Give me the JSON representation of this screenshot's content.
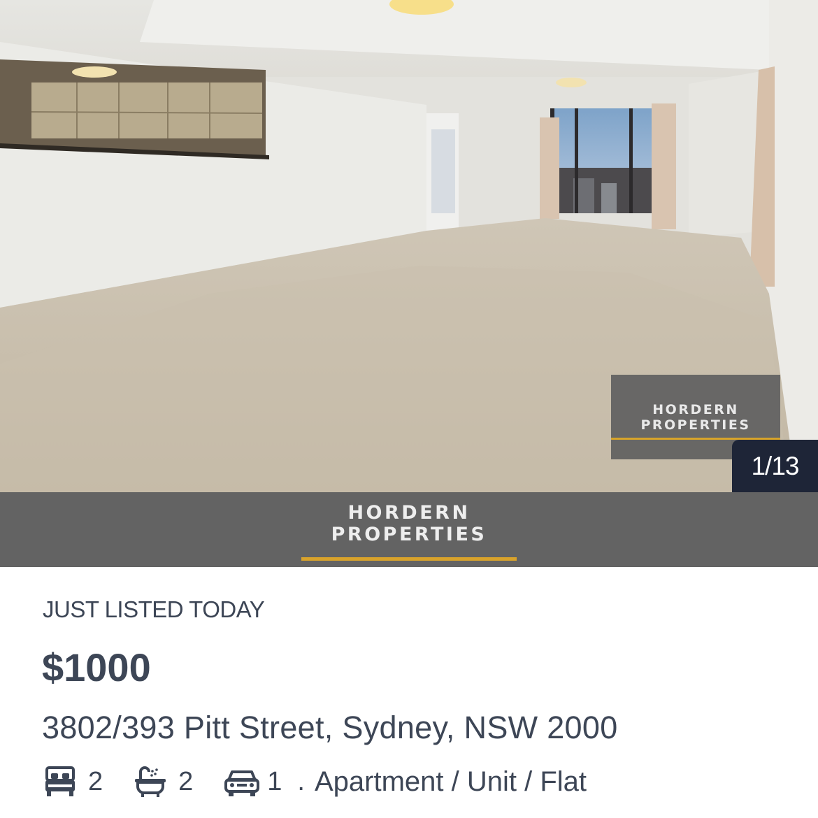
{
  "photo": {
    "watermark_line1": "HORDERN",
    "watermark_line2": "PROPERTIES",
    "counter": "1/13"
  },
  "agency": {
    "logo_line1": "HORDERN",
    "logo_line2": "PROPERTIES"
  },
  "listing": {
    "tag": "JUST LISTED TODAY",
    "price": "$1000",
    "address": "3802/393 Pitt Street, Sydney, NSW 2000",
    "bedrooms": "2",
    "bathrooms": "2",
    "parking": "1",
    "separator": ".",
    "property_type": "Apartment / Unit / Flat",
    "icons": [
      "bed-icon",
      "bath-icon",
      "car-icon"
    ]
  },
  "colors": {
    "text": "#3d4656",
    "agency_bar": "#636363",
    "accent": "#d9a32b",
    "counter_bg": "#1e2537"
  }
}
